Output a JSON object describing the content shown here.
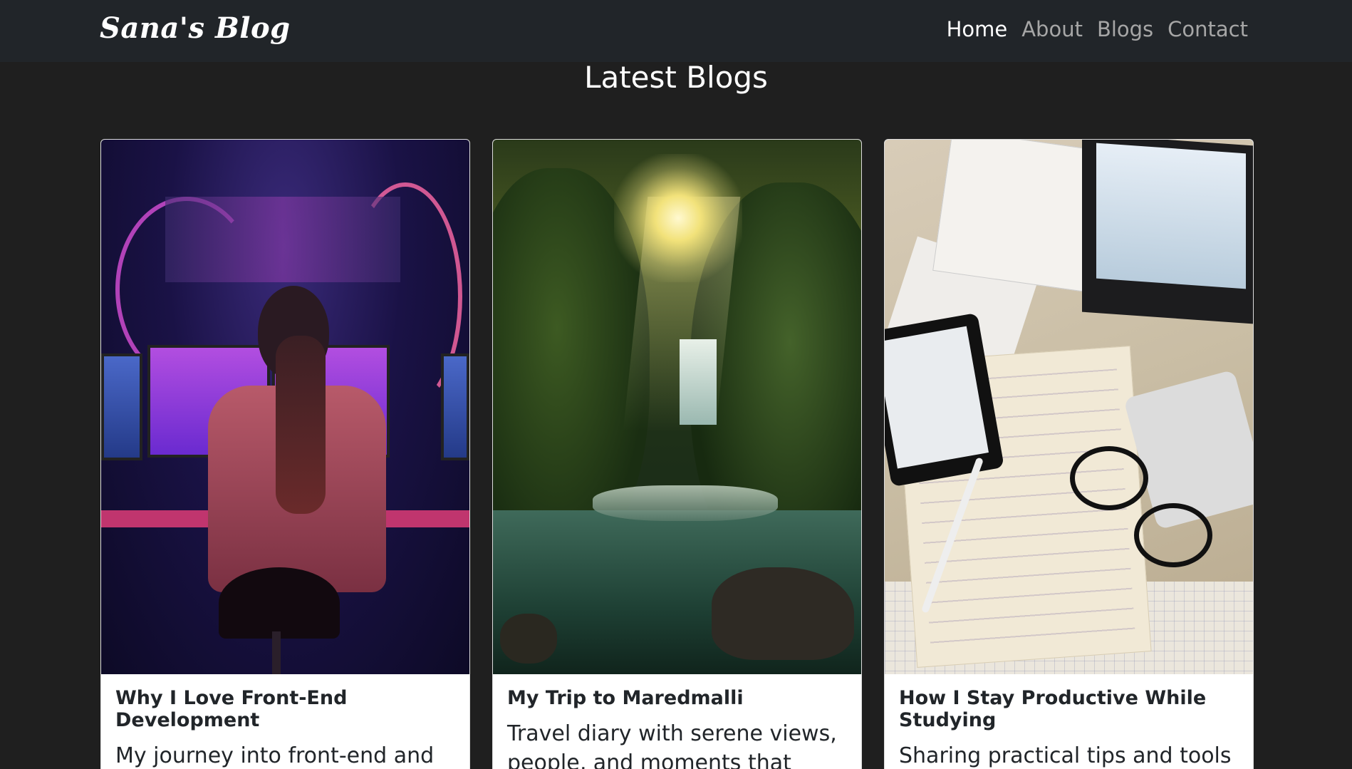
{
  "navbar": {
    "brand": "Sana's Blog",
    "links": [
      {
        "label": "Home",
        "active": true
      },
      {
        "label": "About",
        "active": false
      },
      {
        "label": "Blogs",
        "active": false
      },
      {
        "label": "Contact",
        "active": false
      }
    ]
  },
  "section": {
    "title": "Latest Blogs"
  },
  "cards": [
    {
      "title": "Why I Love Front-End Development",
      "text": "My journey into front-end and how it fuels my creativity."
    },
    {
      "title": "My Trip to Maredmalli",
      "text": "Travel diary with serene views, people, and moments that stayed."
    },
    {
      "title": "How I Stay Productive While Studying",
      "text": "Sharing practical tips and tools I use to stay on track."
    }
  ],
  "colors": {
    "navbar_bg": "#212529",
    "page_bg": "#1f1f1f",
    "card_bg": "#ffffff",
    "nav_active": "#ffffff",
    "nav_inactive": "#a6a6a6"
  }
}
